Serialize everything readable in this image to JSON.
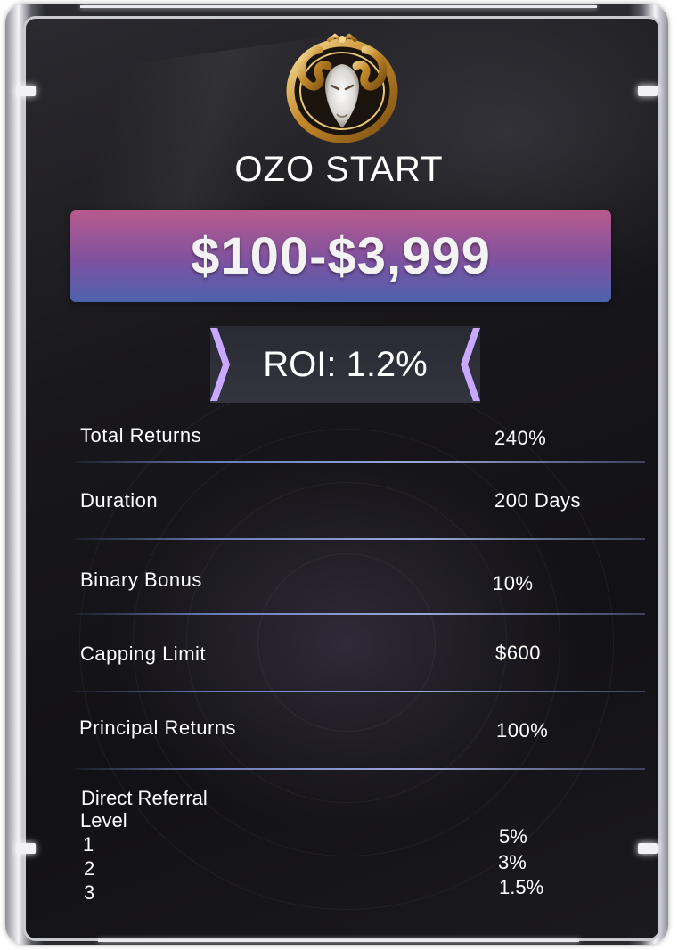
{
  "plan": {
    "title": "OZO START",
    "price_range": "$100-$3,999",
    "roi": "ROI: 1.2%"
  },
  "rows": [
    {
      "label": "Total Returns",
      "value": "240%"
    },
    {
      "label": "Duration",
      "value": "200 Days"
    },
    {
      "label": "Binary Bonus",
      "value": "10%"
    },
    {
      "label": "Capping Limit",
      "value": "$600"
    },
    {
      "label": "Principal Returns",
      "value": "100%"
    }
  ],
  "referral": {
    "title": "Direct Referral",
    "level_header": "Level",
    "levels": [
      {
        "level": "1",
        "value": "5%"
      },
      {
        "level": "2",
        "value": "3%"
      },
      {
        "level": "3",
        "value": "1.5%"
      }
    ]
  },
  "colors": {
    "banner_top": "#b85a8d",
    "banner_bottom": "#4d62ae",
    "card_background": "#18171b",
    "divider": "#9aa9d8",
    "chevron": "#c9a8ff"
  },
  "icons": {
    "emblem": "ram-head-emblem-icon"
  }
}
